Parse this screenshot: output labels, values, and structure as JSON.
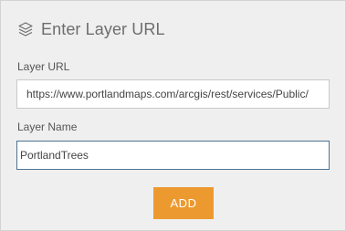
{
  "panel": {
    "title": "Enter Layer URL",
    "title_icon": "layers-icon"
  },
  "form": {
    "url_label": "Layer URL",
    "url_value": "https://www.portlandmaps.com/arcgis/rest/services/Public/",
    "name_label": "Layer Name",
    "name_value": "PortlandTrees",
    "add_label": "ADD"
  },
  "colors": {
    "panel_bg": "#efefef",
    "accent_button": "#ec9a2f",
    "focused_border": "#4d7391"
  }
}
